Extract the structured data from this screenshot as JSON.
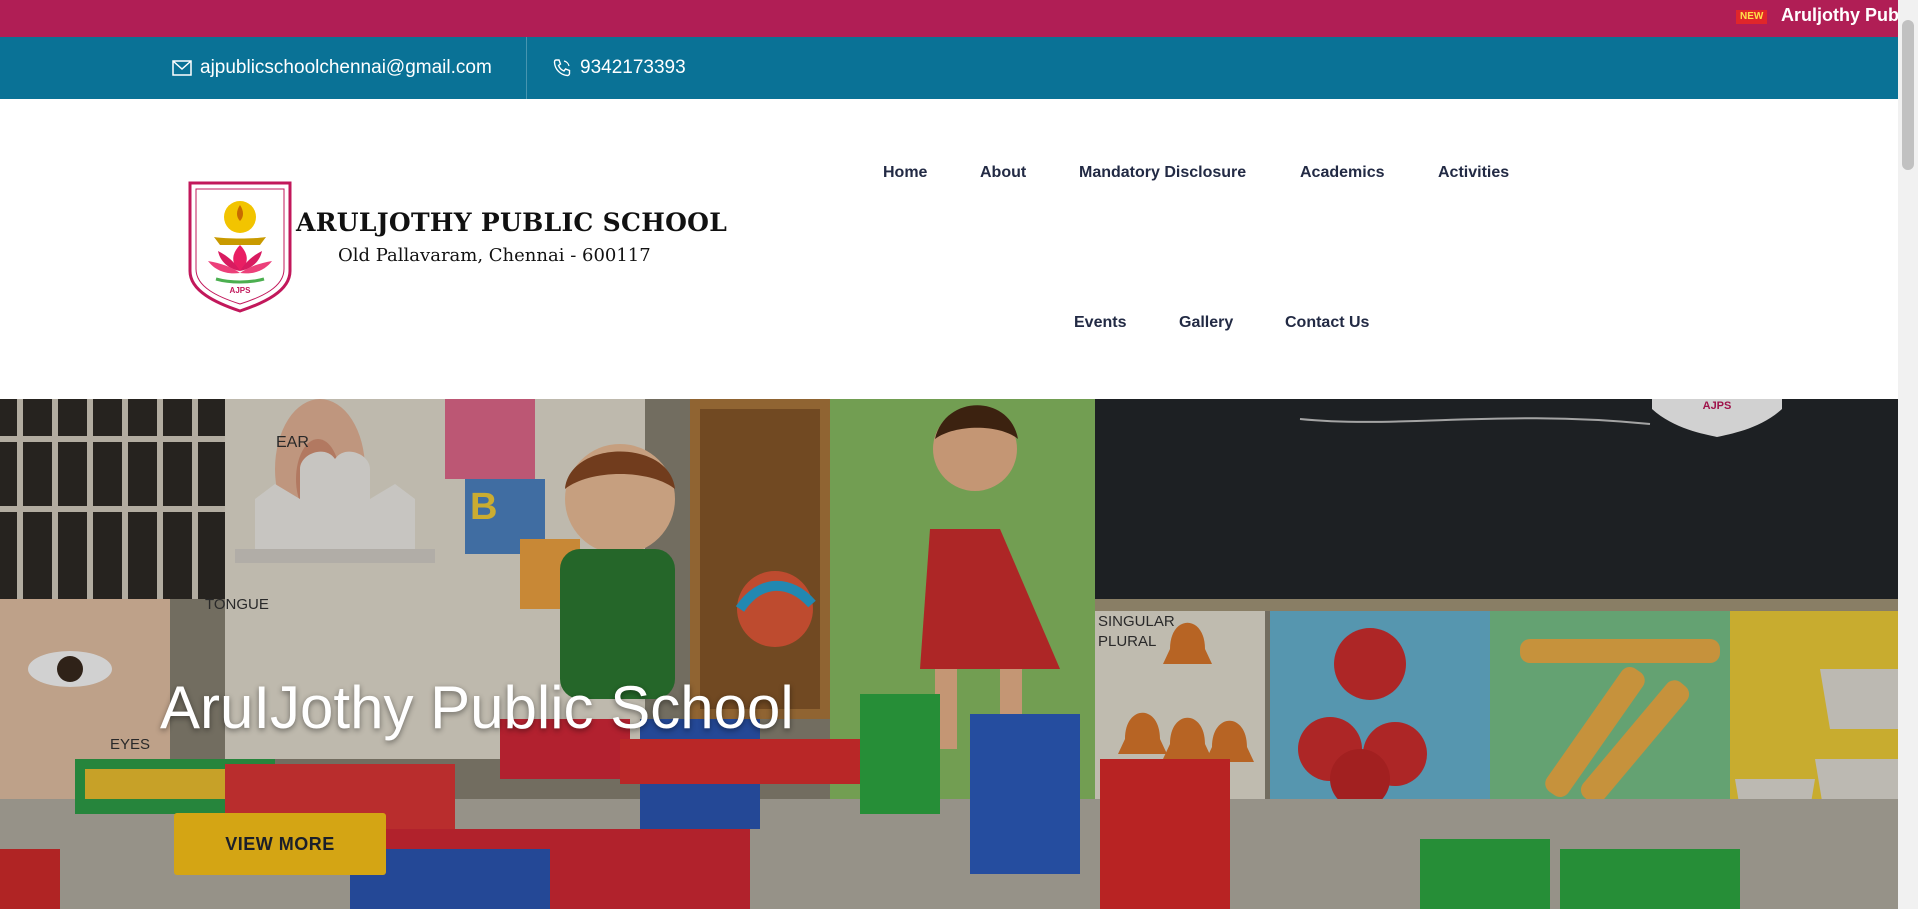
{
  "ticker": {
    "badge": "NEW",
    "text": "Aruljothy Public School"
  },
  "contact": {
    "email": "ajpublicschoolchennai@gmail.com",
    "phone": "9342173393"
  },
  "brand": {
    "name": "ARULJOTHY PUBLIC SCHOOL",
    "address": "Old Pallavaram, Chennai - 600117",
    "logo_text": "AJPS"
  },
  "nav": {
    "items": [
      "Home",
      "About",
      "Mandatory Disclosure",
      "Academics",
      "Activities",
      "Events",
      "Gallery",
      "Contact Us"
    ]
  },
  "hero": {
    "title": "AruIJothy Public School",
    "button_label": "VIEW MORE",
    "badge_text": "AJPS",
    "wall_labels": {
      "ear": "EAR",
      "tongue": "TONGUE",
      "eyes": "EYES",
      "singular": "SINGULAR",
      "plural": "PLURAL"
    }
  },
  "colors": {
    "ticker_bg": "#b01e55",
    "contact_bg": "#0a7296",
    "button_bg": "#d4a514",
    "nav_text": "#222a44"
  }
}
